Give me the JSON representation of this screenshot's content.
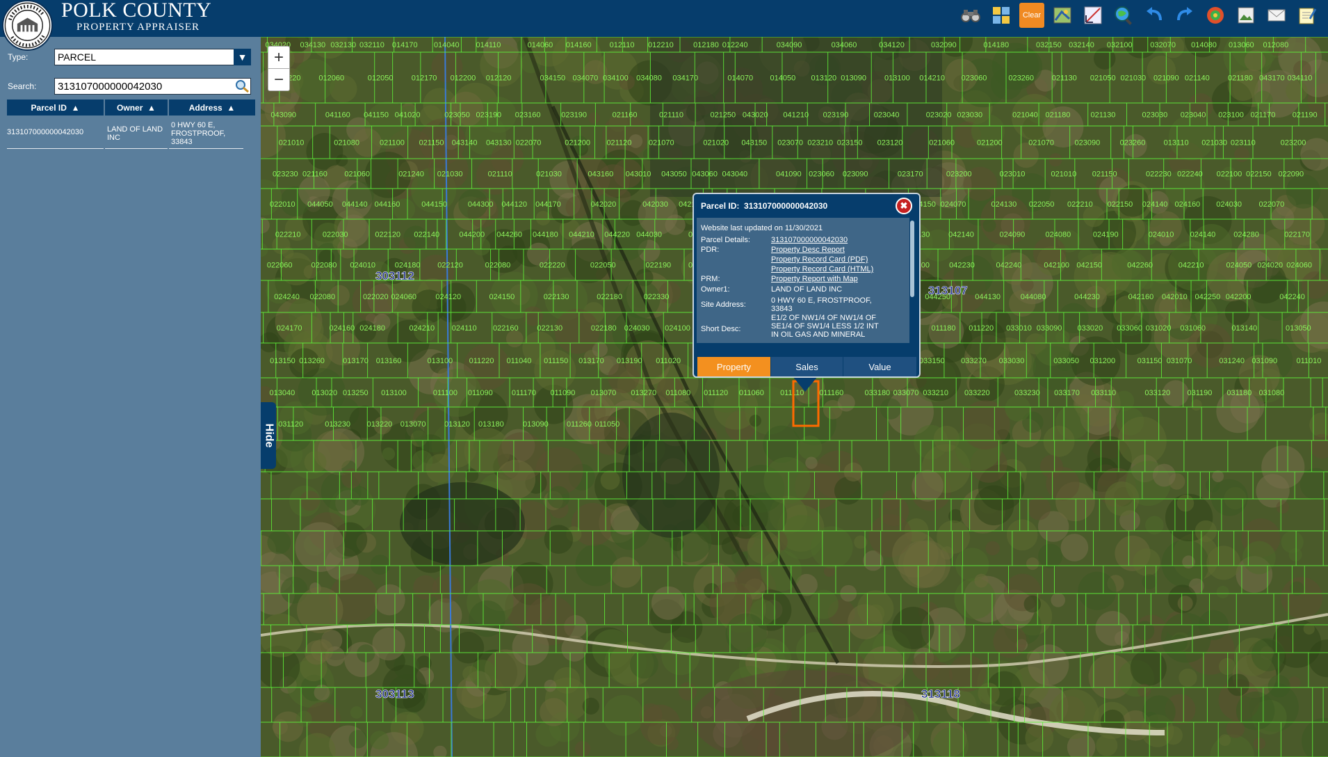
{
  "header": {
    "title": "POLK COUNTY",
    "subtitle": "PROPERTY APPRAISER",
    "logo_text": "PROPERTY APPRAISER",
    "tools": [
      {
        "icon": "binoculars-icon"
      },
      {
        "icon": "grid-icon"
      },
      {
        "icon": "clear-icon",
        "label": "Clear"
      },
      {
        "icon": "map-layers-icon"
      },
      {
        "icon": "measure-icon"
      },
      {
        "icon": "globe-search-icon"
      },
      {
        "icon": "undo-icon"
      },
      {
        "icon": "redo-icon"
      },
      {
        "icon": "target-icon"
      },
      {
        "icon": "image-icon"
      },
      {
        "icon": "email-icon"
      },
      {
        "icon": "notepad-icon"
      }
    ]
  },
  "sidebar": {
    "type_label": "Type:",
    "type_value": "PARCEL",
    "search_label": "Search:",
    "search_value": "313107000000042030",
    "columns": [
      "Parcel ID",
      "Owner",
      "Address"
    ],
    "rows": [
      {
        "parcel_id": "313107000000042030",
        "owner_l1": "LAND OF LAND",
        "owner_l2": "INC",
        "addr_l1": "0 HWY 60 E,",
        "addr_l2": "FROSTPROOF,",
        "addr_l3": "33843"
      }
    ],
    "hide_label": "Hide"
  },
  "popup": {
    "title_label": "Parcel ID:",
    "title_value": "313107000000042030",
    "updated": "Website last updated on 11/30/2021",
    "parcel_details_label": "Parcel Details:",
    "parcel_details_value": "313107000000042030",
    "pdr_label": "PDR:",
    "pdr_links": [
      "Property Desc Report",
      "Property Record Card (PDF)",
      "Property Record Card (HTML)"
    ],
    "prm_label": "PRM:",
    "prm_link": "Property Report with Map",
    "owner_label": "Owner1:",
    "owner_value": "LAND OF LAND INC",
    "site_label": "Site Address:",
    "site_l1": "0 HWY 60 E, FROSTPROOF,",
    "site_l2": "33843",
    "desc_label": "Short Desc:",
    "desc_l1": "E1/2 OF NW1/4 OF NW1/4 OF",
    "desc_l2": "SE1/4 OF SW1/4 LESS 1/2 INT",
    "desc_l3": "IN OIL GAS AND MINERAL",
    "tabs": [
      "Property",
      "Sales",
      "Value"
    ]
  },
  "map": {
    "sections": [
      "303112",
      "313107",
      "303113",
      "313118"
    ],
    "lots": [
      "034020",
      "034130",
      "032130",
      "032110",
      "014170",
      "014040",
      "014110",
      "014060",
      "014160",
      "012110",
      "012210",
      "012180",
      "012240",
      "034090",
      "034060",
      "034120",
      "032090",
      "014180",
      "032150",
      "032140",
      "032100",
      "032070",
      "014080",
      "013060",
      "012080",
      "012220",
      "012060",
      "012050",
      "012170",
      "012200",
      "012120",
      "034150",
      "034070",
      "034100",
      "034080",
      "034170",
      "014070",
      "014050",
      "013120",
      "013090",
      "013100",
      "014210",
      "023060",
      "023260",
      "021130",
      "021050",
      "021030",
      "021090",
      "021140",
      "021180",
      "043170",
      "034110",
      "043090",
      "041160",
      "041150",
      "041020",
      "023050",
      "023190",
      "023160",
      "023190",
      "021160",
      "021110",
      "021250",
      "043020",
      "041210",
      "023190",
      "023040",
      "023020",
      "023030",
      "021040",
      "021180",
      "021130",
      "023030",
      "023040",
      "023100",
      "021170",
      "021190",
      "021010",
      "021080",
      "021100",
      "021150",
      "043140",
      "043130",
      "022070",
      "021200",
      "021120",
      "021070",
      "021020",
      "043150",
      "023070",
      "023210",
      "023150",
      "023120",
      "021060",
      "021200",
      "021070",
      "023090",
      "023260",
      "013110",
      "021030",
      "023110",
      "023200",
      "023230",
      "021160",
      "021060",
      "021240",
      "021030",
      "021110",
      "021030",
      "043160",
      "043010",
      "043050",
      "043060",
      "043040",
      "041090",
      "023060",
      "023090",
      "023170",
      "023200",
      "023010",
      "021010",
      "021150",
      "022230",
      "022240",
      "022100",
      "022150",
      "022090",
      "022010",
      "044050",
      "044140",
      "044160",
      "044150",
      "044300",
      "044120",
      "044170",
      "042020",
      "042030",
      "042180",
      "042110",
      "042050",
      "024100",
      "024230",
      "024150",
      "024070",
      "024130",
      "022050",
      "022210",
      "022150",
      "024140",
      "024160",
      "024030",
      "022070",
      "022210",
      "022030",
      "022120",
      "022140",
      "044200",
      "044260",
      "044180",
      "044210",
      "044220",
      "044030",
      "042120",
      "042060",
      "042190",
      "042170",
      "042240",
      "042090",
      "042130",
      "042140",
      "024090",
      "024080",
      "024190",
      "024010",
      "024140",
      "024280",
      "022170",
      "022060",
      "022080",
      "024010",
      "024180",
      "022120",
      "022080",
      "022220",
      "022050",
      "022190",
      "022230",
      "022040",
      "044060",
      "044010",
      "044240",
      "044040",
      "044100",
      "042230",
      "042240",
      "042100",
      "042150",
      "042260",
      "042210",
      "024050",
      "024020",
      "024060",
      "024240",
      "022080",
      "022020",
      "024060",
      "024120",
      "024150",
      "022130",
      "022180",
      "022330",
      "022160",
      "022170",
      "022200",
      "022250",
      "044070",
      "044090",
      "044250",
      "044130",
      "044080",
      "044230",
      "042160",
      "042010",
      "042250",
      "042200",
      "042240",
      "024170",
      "024160",
      "024180",
      "024210",
      "024110",
      "022160",
      "022130",
      "022180",
      "024030",
      "024100",
      "013240",
      "013090",
      "011210",
      "011220",
      "011140",
      "011190",
      "011180",
      "011220",
      "033010",
      "033090",
      "033020",
      "033060",
      "031020",
      "031060",
      "013140",
      "013050",
      "013150",
      "013260",
      "013170",
      "013160",
      "013100",
      "011220",
      "011040",
      "011150",
      "013170",
      "013190",
      "011020",
      "011230",
      "011100",
      "011040",
      "011010",
      "033160",
      "033150",
      "033270",
      "033030",
      "033050",
      "031200",
      "031150",
      "031070",
      "031240",
      "031090",
      "011010",
      "013040",
      "013020",
      "013250",
      "013100",
      "011100",
      "011090",
      "011170",
      "011090",
      "013070",
      "013270",
      "011080",
      "011120",
      "011060",
      "011110",
      "011160",
      "033180",
      "033070",
      "033210",
      "033220",
      "033230",
      "033170",
      "033110",
      "033120",
      "031190",
      "031180",
      "031080",
      "031120",
      "013230",
      "013220",
      "013070",
      "013120",
      "013180",
      "013090",
      "011260",
      "011050"
    ]
  }
}
